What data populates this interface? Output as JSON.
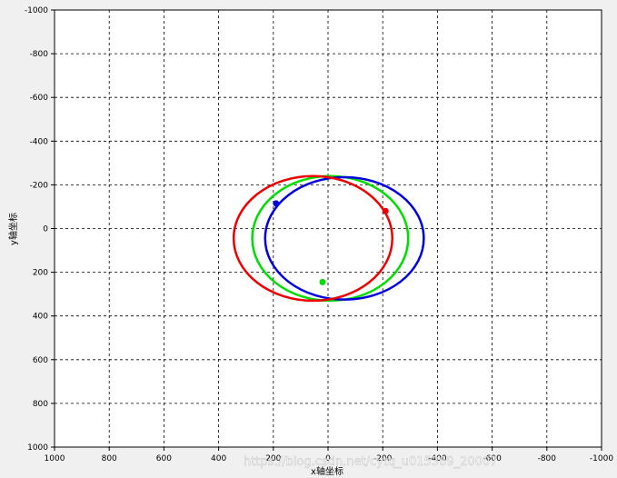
{
  "chart_data": {
    "type": "line",
    "xlabel": "x轴坐标",
    "ylabel": "y轴坐标",
    "xlim": [
      1000,
      -1000
    ],
    "ylim": [
      -1000,
      1000
    ],
    "x_ticks": [
      1000,
      800,
      600,
      400,
      200,
      0,
      -200,
      -400,
      -600,
      -800,
      -1000
    ],
    "y_ticks": [
      -1000,
      -800,
      -600,
      -400,
      -200,
      0,
      200,
      400,
      600,
      800,
      1000
    ],
    "grid": true,
    "series": [
      {
        "color": "#00dd00",
        "shape": "ellipse",
        "center": [
          -8,
          45
        ],
        "radii": [
          285,
          285
        ],
        "marker": [
          20,
          245
        ]
      },
      {
        "color": "#0000dd",
        "shape": "ellipse",
        "center": [
          -60,
          45
        ],
        "radii": [
          290,
          280
        ],
        "marker": [
          190,
          -115
        ]
      },
      {
        "color": "#ee0000",
        "shape": "ellipse",
        "center": [
          55,
          45
        ],
        "radii": [
          290,
          285
        ],
        "marker": [
          -210,
          -80
        ]
      }
    ],
    "watermark": "https://blog.csdn.net/cytq_u015369_20007"
  }
}
